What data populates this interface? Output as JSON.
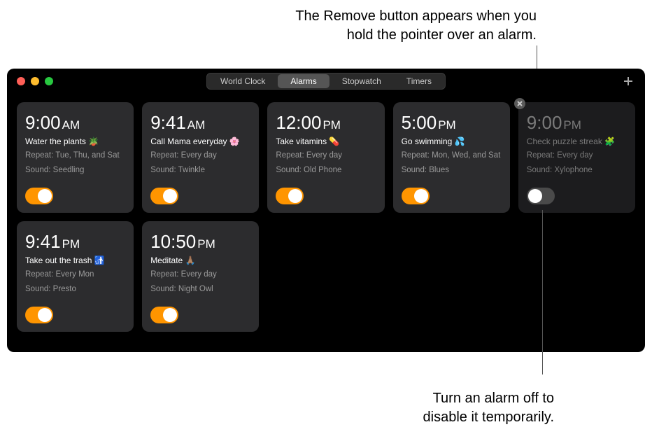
{
  "callouts": {
    "top": "The Remove button appears when you\nhold the pointer over an alarm.",
    "bottom": "Turn an alarm off to\ndisable it temporarily."
  },
  "tabs": [
    {
      "label": "World Clock",
      "active": false
    },
    {
      "label": "Alarms",
      "active": true
    },
    {
      "label": "Stopwatch",
      "active": false
    },
    {
      "label": "Timers",
      "active": false
    }
  ],
  "alarms": [
    {
      "time": "9:00",
      "period": "AM",
      "label": "Water the plants 🪴",
      "repeat": "Repeat: Tue, Thu, and Sat",
      "sound": "Sound: Seedling",
      "on": true,
      "show_remove": false
    },
    {
      "time": "9:41",
      "period": "AM",
      "label": "Call Mama everyday 🌸",
      "repeat": "Repeat: Every day",
      "sound": "Sound: Twinkle",
      "on": true,
      "show_remove": false
    },
    {
      "time": "12:00",
      "period": "PM",
      "label": "Take vitamins 💊",
      "repeat": "Repeat: Every day",
      "sound": "Sound: Old Phone",
      "on": true,
      "show_remove": false
    },
    {
      "time": "5:00",
      "period": "PM",
      "label": "Go swimming 💦",
      "repeat": "Repeat: Mon, Wed, and Sat",
      "sound": "Sound: Blues",
      "on": true,
      "show_remove": false
    },
    {
      "time": "9:00",
      "period": "PM",
      "label": "Check puzzle streak 🧩",
      "repeat": "Repeat: Every day",
      "sound": "Sound: Xylophone",
      "on": false,
      "show_remove": true
    },
    {
      "time": "9:41",
      "period": "PM",
      "label": "Take out the trash 🚮",
      "repeat": "Repeat: Every Mon",
      "sound": "Sound: Presto",
      "on": true,
      "show_remove": false
    },
    {
      "time": "10:50",
      "period": "PM",
      "label": "Meditate 🙏🏽",
      "repeat": "Repeat: Every day",
      "sound": "Sound: Night Owl",
      "on": true,
      "show_remove": false
    }
  ]
}
